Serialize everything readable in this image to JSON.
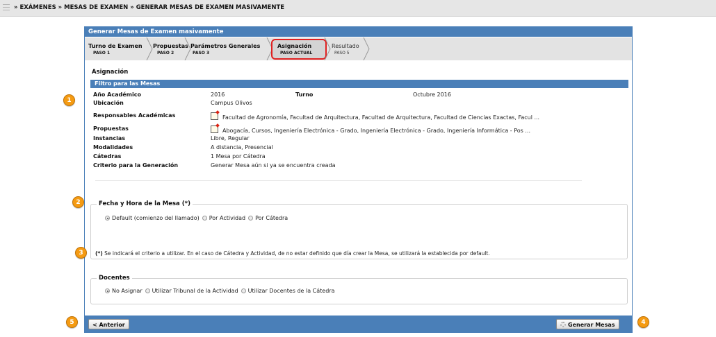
{
  "breadcrumb": "» EXÁMENES » MESAS DE EXAMEN » GENERAR MESAS DE EXAMEN MASIVAMENTE",
  "panel": {
    "title": "Generar Mesas de Examen masivamente"
  },
  "steps": [
    {
      "title": "Turno de Examen",
      "sub": "PASO 1"
    },
    {
      "title": "Propuestas",
      "sub": "PASO 2"
    },
    {
      "title": "Parámetros Generales",
      "sub": "PASO 3"
    },
    {
      "title": "Asignación",
      "sub": "PASO ACTUAL"
    },
    {
      "title": "Resultado",
      "sub": "PASO 5"
    }
  ],
  "section_title": "Asignación",
  "filter": {
    "header": "Filtro para las Mesas",
    "anio_label": "Año Académico",
    "anio_value": "2016",
    "turno_label": "Turno",
    "turno_value": "Octubre 2016",
    "ubicacion_label": "Ubicación",
    "ubicacion_value": "Campus Olivos",
    "responsables_label": "Responsables Académicas",
    "responsables_value": "Facultad de Agronomía, Facultad de Arquitectura, Facultad de Arquitectura, Facultad de Ciencias Exactas, Facul ...",
    "propuestas_label": "Propuestas",
    "propuestas_value": "Abogacía, Cursos, Ingeniería Electrónica - Grado, Ingeniería Electrónica - Grado, Ingeniería Informática - Pos ...",
    "instancias_label": "Instancias",
    "instancias_value": "Libre, Regular",
    "modalidades_label": "Modalidades",
    "modalidades_value": "A distancia, Presencial",
    "catedras_label": "Cátedras",
    "catedras_value": "1 Mesa por Cátedra",
    "criterio_label": "Criterio para la Generación",
    "criterio_value": "Generar Mesa aún si ya se encuentra creada"
  },
  "fecha": {
    "legend": "Fecha y Hora de la Mesa (*)",
    "options": [
      "Default (comienzo del llamado)",
      "Por Actividad",
      "Por Cátedra"
    ],
    "selected": 0,
    "note_mark": "(*)",
    "note": "Se indicará el criterio a utilizar. En el caso de Cátedra y Actividad, de no estar definido que día crear la Mesa, se utilizará la establecida por default."
  },
  "docentes": {
    "legend": "Docentes",
    "options": [
      "No Asignar",
      "Utilizar Tribunal de la Actividad",
      "Utilizar Docentes de la Cátedra"
    ],
    "selected": 0
  },
  "buttons": {
    "anterior": "< Anterior",
    "generar": "Generar Mesas"
  },
  "badges": [
    "1",
    "2",
    "3",
    "4",
    "5"
  ],
  "colors": {
    "accent": "#4a7fb8",
    "badge": "#f59b12",
    "highlight": "#e02020"
  }
}
